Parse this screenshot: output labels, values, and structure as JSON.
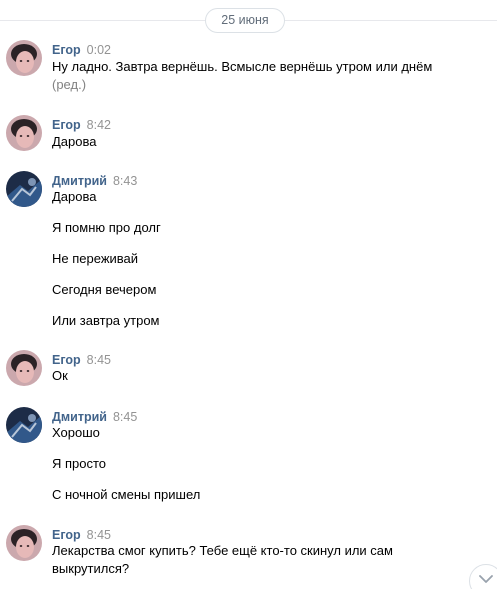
{
  "date_divider": "25 июня",
  "messages": [
    {
      "author": "Егор",
      "time": "0:02",
      "lines": [
        "Ну ладно. Завтра вернёшь. Всмысле вернёшь утром или днём"
      ],
      "edited": "(ред.)"
    },
    {
      "author": "Егор",
      "time": "8:42",
      "lines": [
        "Дарова"
      ]
    },
    {
      "author": "Дмитрий",
      "time": "8:43",
      "lines": [
        "Дарова",
        "Я помню про долг",
        "Не переживай",
        "Сегодня вечером",
        "Или завтра утром"
      ]
    },
    {
      "author": "Егор",
      "time": "8:45",
      "lines": [
        "Ок"
      ]
    },
    {
      "author": "Дмитрий",
      "time": "8:45",
      "lines": [
        "Хорошо",
        "Я просто",
        "С ночной смены пришел"
      ]
    },
    {
      "author": "Егор",
      "time": "8:45",
      "lines": [
        "Лекарства смог купить? Тебе ещё кто-то скинул или сам",
        "выкрутился?"
      ]
    }
  ],
  "icons": {
    "scroll_down": "chevron-down-icon"
  },
  "colors": {
    "author": "#42648b",
    "time": "#939393",
    "text": "#000000",
    "divider": "#e7e8ec"
  }
}
